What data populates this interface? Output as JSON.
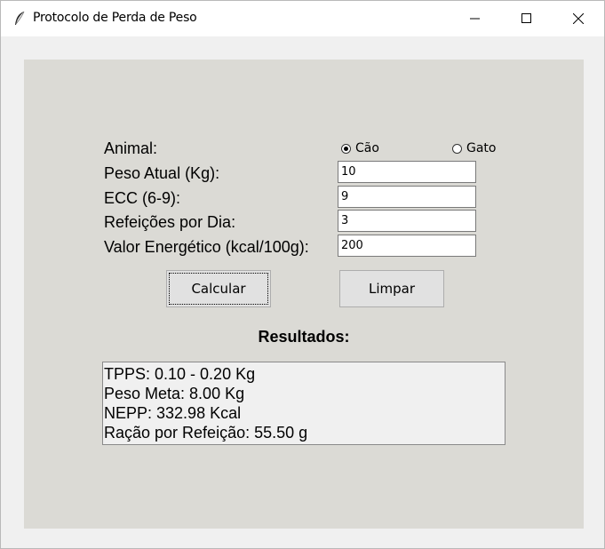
{
  "window": {
    "title": "Protocolo de Perda de Peso"
  },
  "form": {
    "animal_label": "Animal:",
    "animal_options": [
      {
        "label": "Cão",
        "checked": true
      },
      {
        "label": "Gato",
        "checked": false
      }
    ],
    "peso_label": "Peso Atual (Kg):",
    "peso_value": "10",
    "ecc_label": "ECC (6-9):",
    "ecc_value": "9",
    "refeicoes_label": "Refeições por Dia:",
    "refeicoes_value": "3",
    "energia_label": "Valor Energético (kcal/100g):",
    "energia_value": "200"
  },
  "buttons": {
    "calcular": "Calcular",
    "limpar": "Limpar"
  },
  "results": {
    "title": "Resultados:",
    "lines": [
      "TPPS: 0.10 - 0.20 Kg",
      "Peso Meta: 8.00 Kg",
      "NEPP: 332.98 Kcal",
      "Ração por Refeição: 55.50 g"
    ]
  }
}
